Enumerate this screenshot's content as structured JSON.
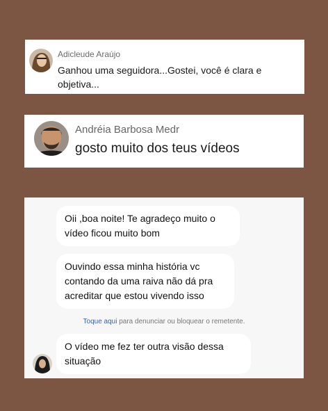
{
  "comment1": {
    "author": "Adicleude Araújo",
    "text": "Ganhou uma seguidora...Gostei, você é clara e objetiva..."
  },
  "comment2": {
    "author": "Andréia Barbosa Medr",
    "text": "gosto muito dos teus vídeos"
  },
  "chat": {
    "messages": [
      "Oii ,boa noite! Te agradeço muito o vídeo ficou muito bom",
      "Ouvindo essa minha história vc contando da uma raiva não dá pra acreditar que estou vivendo isso",
      "O vídeo me fez ter outra visão dessa situação"
    ],
    "notice_link": "Toque aqui",
    "notice_text": " para denunciar ou bloquear o remetente."
  }
}
